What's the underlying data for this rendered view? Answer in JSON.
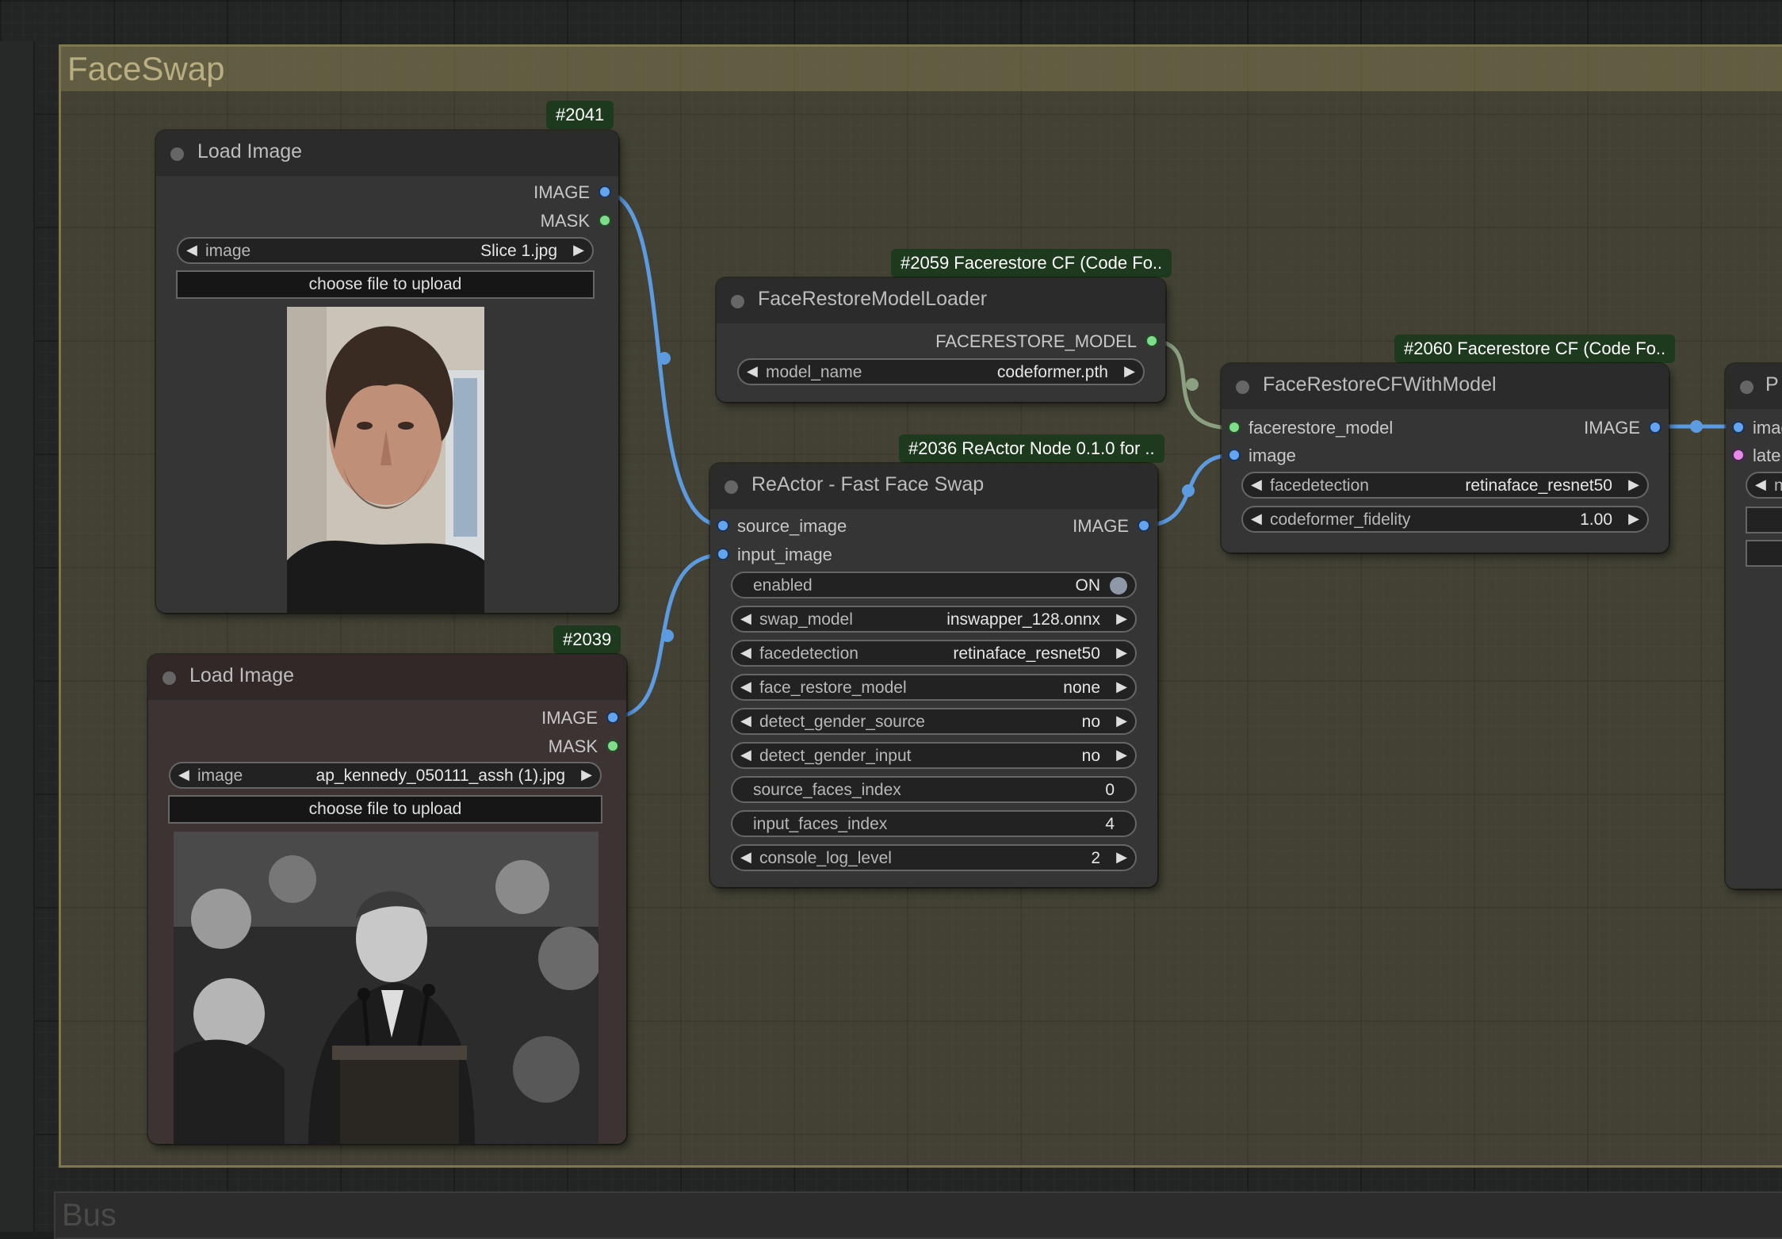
{
  "group": {
    "title": "FaceSwap"
  },
  "bus_group": {
    "title": "Bus"
  },
  "nodes": {
    "load_image_2041": {
      "badge": "#2041",
      "title": "Load Image",
      "outputs": [
        "IMAGE",
        "MASK"
      ],
      "image_widget": {
        "name": "image",
        "value": "Slice 1.jpg"
      },
      "upload_label": "choose file to upload",
      "preview_alt": "man with curly hair portrait"
    },
    "load_image_2039": {
      "badge": "#2039",
      "title": "Load Image",
      "outputs": [
        "IMAGE",
        "MASK"
      ],
      "image_widget": {
        "name": "image",
        "value": "ap_kennedy_050111_assh (1).jpg"
      },
      "upload_label": "choose file to upload",
      "preview_alt": "black and white photo of speaker at podium"
    },
    "facerestore_loader": {
      "badge": "#2059 Facerestore CF (Code Fo..",
      "title": "FaceRestoreModelLoader",
      "output": "FACERESTORE_MODEL",
      "model_widget": {
        "name": "model_name",
        "value": "codeformer.pth"
      }
    },
    "reactor": {
      "badge": "#2036 ReActor Node 0.1.0 for ..",
      "title": "ReActor - Fast Face Swap",
      "inputs": [
        "source_image",
        "input_image"
      ],
      "output": "IMAGE",
      "widgets": [
        {
          "name": "enabled",
          "value": "ON"
        },
        {
          "name": "swap_model",
          "value": "inswapper_128.onnx"
        },
        {
          "name": "facedetection",
          "value": "retinaface_resnet50"
        },
        {
          "name": "face_restore_model",
          "value": "none"
        },
        {
          "name": "detect_gender_source",
          "value": "no"
        },
        {
          "name": "detect_gender_input",
          "value": "no"
        },
        {
          "name": "source_faces_index",
          "value": "0"
        },
        {
          "name": "input_faces_index",
          "value": "4"
        },
        {
          "name": "console_log_level",
          "value": "2"
        }
      ]
    },
    "facerestore_cf": {
      "badge": "#2060 Facerestore CF (Code Fo..",
      "title": "FaceRestoreCFWithModel",
      "inputs": [
        "facerestore_model",
        "image"
      ],
      "output": "IMAGE",
      "widgets": [
        {
          "name": "facedetection",
          "value": "retinaface_resnet50"
        },
        {
          "name": "codeformer_fidelity",
          "value": "1.00"
        }
      ]
    },
    "partial_node": {
      "title": "P",
      "inputs": [
        "imag",
        "late"
      ],
      "widget_fragment": "n"
    }
  },
  "colors": {
    "image_link": "#5c9be0",
    "model_link": "#8aa080",
    "group_bg": "#5b5638"
  },
  "icons": {
    "left_arrow": "left-arrow-icon",
    "right_arrow": "right-arrow-icon"
  }
}
